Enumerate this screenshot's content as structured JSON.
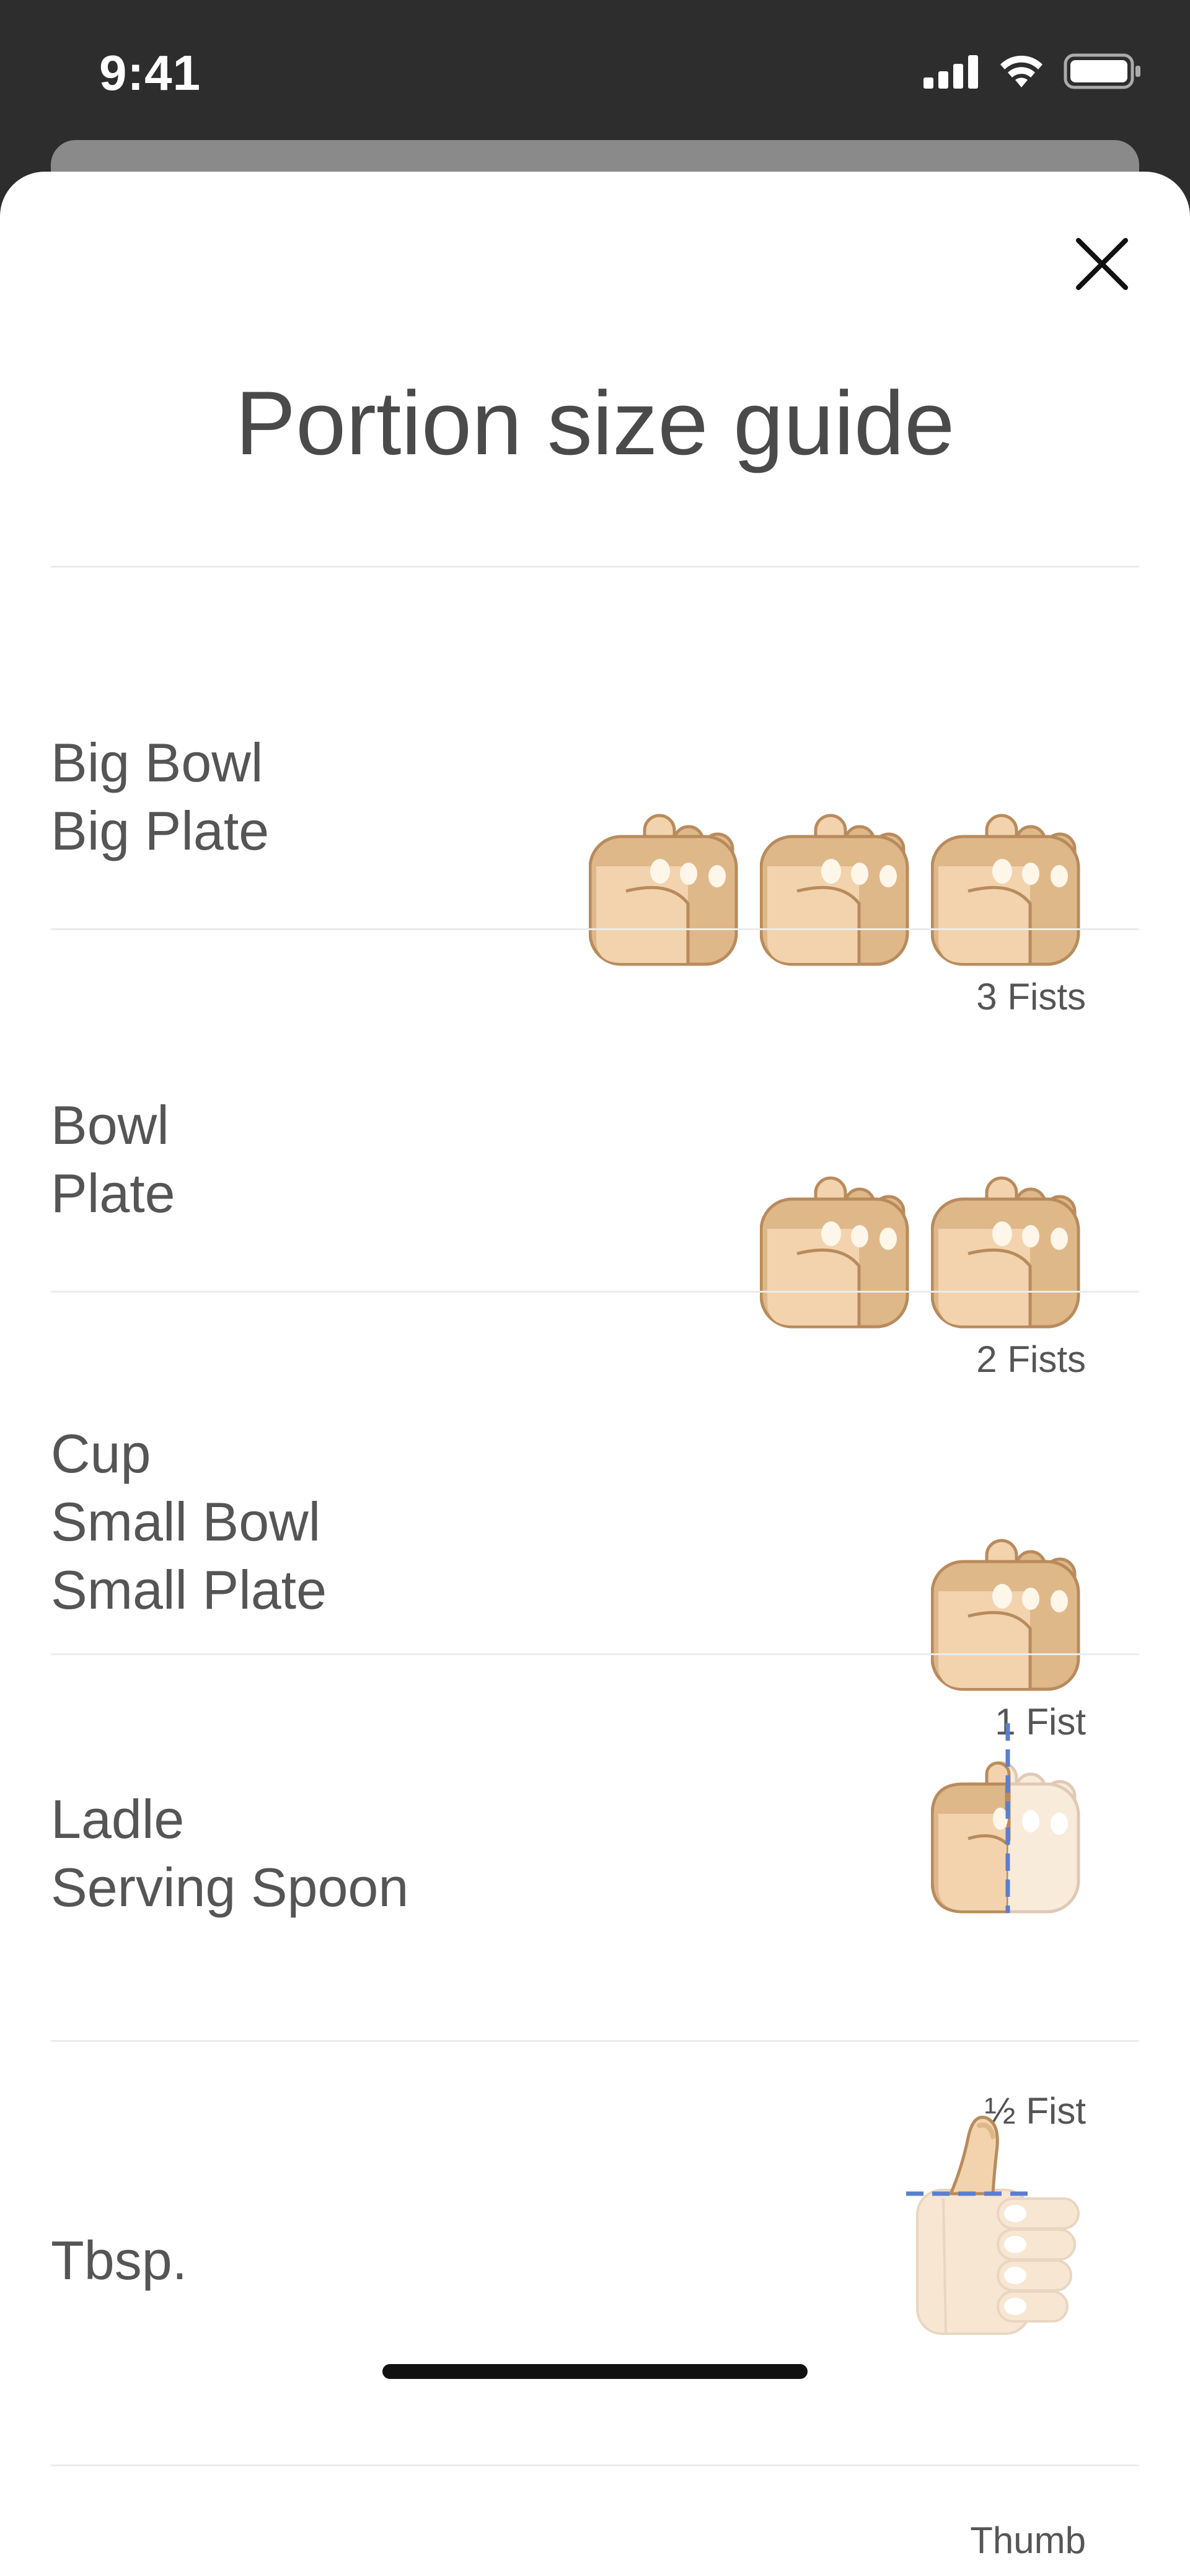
{
  "status_bar": {
    "time": "9:41"
  },
  "modal": {
    "title": "Portion size guide",
    "rows": [
      {
        "lines": [
          "Big Bowl",
          "Big Plate"
        ],
        "count": 3,
        "caption": "3 Fists"
      },
      {
        "lines": [
          "Bowl",
          "Plate"
        ],
        "count": 2,
        "caption": "2 Fists"
      },
      {
        "lines": [
          "Cup",
          "Small Bowl",
          "Small Plate"
        ],
        "count": 1,
        "caption": "1 Fist"
      },
      {
        "lines": [
          "Ladle",
          "Serving Spoon"
        ],
        "count": 0.5,
        "caption": "½ Fist"
      },
      {
        "lines": [
          "Tbsp."
        ],
        "caption": "Thumb"
      }
    ]
  },
  "colors": {
    "skin_light": "#f2d3ae",
    "skin_mid": "#dfb88a",
    "skin_outline": "#b98b5c",
    "guide_line": "#5b7fcf",
    "text": "#555555"
  }
}
